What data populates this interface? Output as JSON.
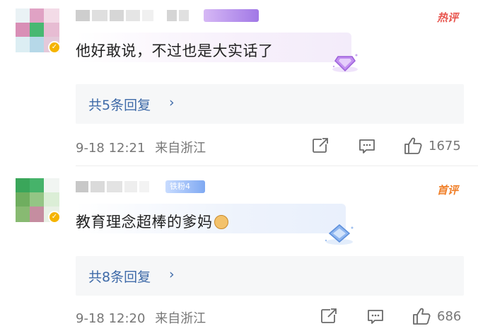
{
  "comments": [
    {
      "username_badge": "",
      "hot_tag": "热评",
      "text": "他好敢说，不过也是大实话了",
      "replies_label": "共5条回复",
      "chevron": "›",
      "time": "9-18 12:21",
      "location": "来自浙江",
      "likes": "1675",
      "avatar_colors": [
        "#f0d8e3",
        "#d888ad",
        "#c6e9d2",
        "#e4bfd5",
        "#4fbf7a",
        "#d79bc0",
        "#d7e8ee",
        "#b4d7e6",
        "#f5b400"
      ]
    },
    {
      "username_badge": "铁粉4",
      "hot_tag": "首评",
      "text": "教育理念超棒的爹妈",
      "replies_label": "共8条回复",
      "chevron": "›",
      "time": "9-18 12:20",
      "location": "来自浙江",
      "likes": "686",
      "avatar_colors": [
        "#3aa65a",
        "#5cc27b",
        "#e6f0e8",
        "#77b06b",
        "#9ac98c",
        "#d4e8d0",
        "#8fbf7a",
        "#c88fa0",
        "#f5b400"
      ]
    }
  ],
  "icons": {
    "share": "share-icon",
    "comment": "comment-icon",
    "like": "thumbs-up-icon",
    "verify": "verified-icon",
    "gem": "diamond-badge-icon"
  },
  "colors": {
    "link": "#3e6aa8",
    "hot_red": "#e8554e",
    "first_orange": "#f07f28",
    "reply_bg": "#f6f7f8"
  }
}
